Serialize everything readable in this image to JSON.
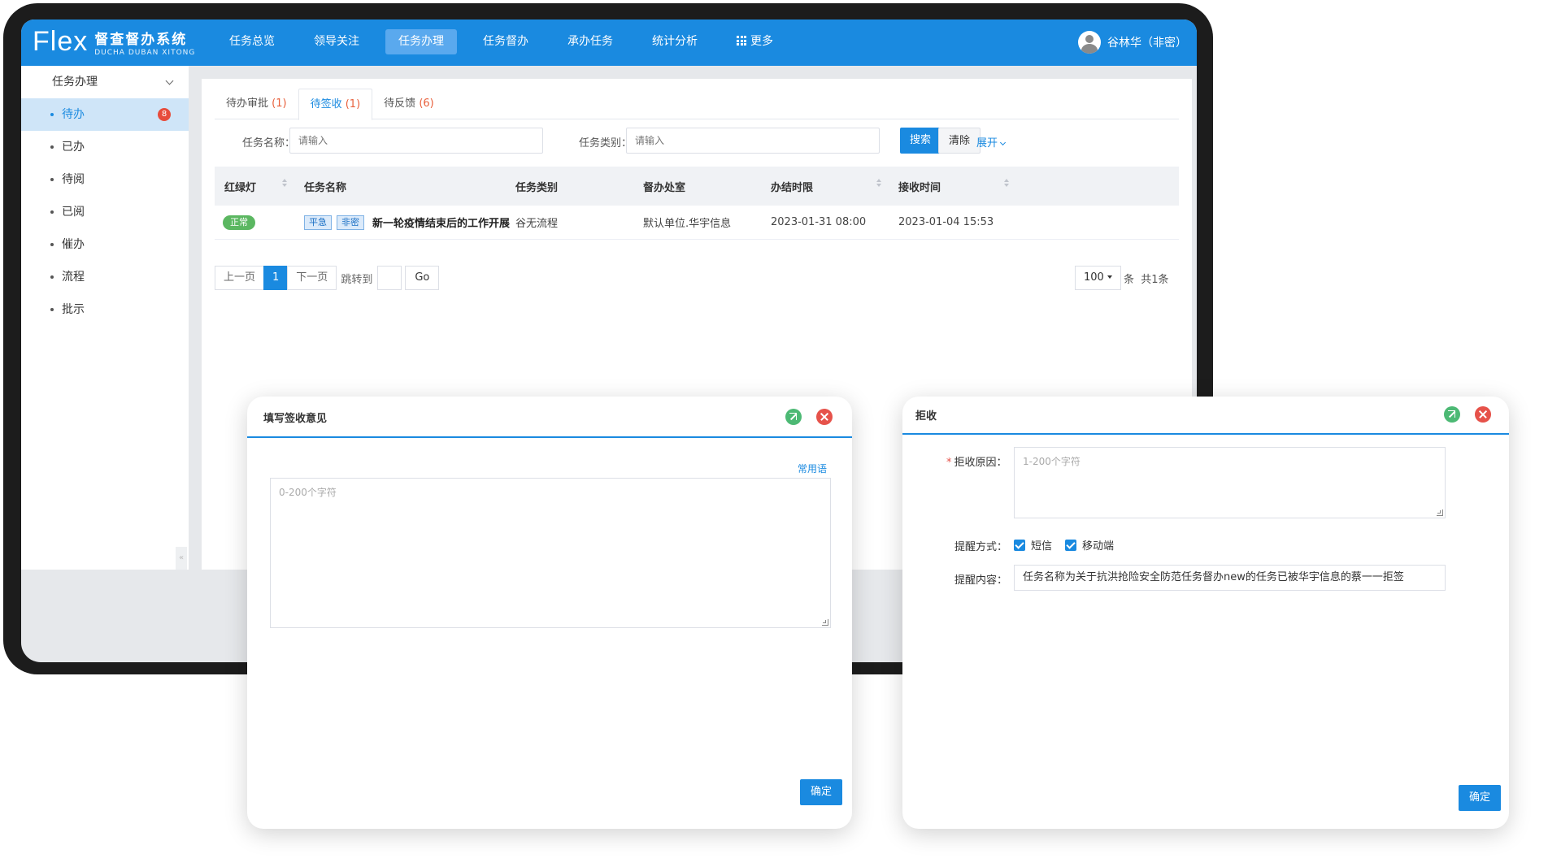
{
  "app": {
    "logo_mark": "Flex",
    "title_cn": "督查督办系统",
    "title_en": "DUCHA DUBAN XITONG"
  },
  "nav": {
    "items": [
      {
        "label": "任务总览"
      },
      {
        "label": "领导关注"
      },
      {
        "label": "任务办理",
        "active": true
      },
      {
        "label": "任务督办"
      },
      {
        "label": "承办任务"
      },
      {
        "label": "统计分析"
      },
      {
        "label": "更多",
        "icon": "grid-icon"
      }
    ],
    "user_name": "谷林华（非密）"
  },
  "sidebar": {
    "header": "任务办理",
    "items": [
      {
        "label": "待办",
        "badge": "8",
        "active": true
      },
      {
        "label": "已办"
      },
      {
        "label": "待阅"
      },
      {
        "label": "已阅"
      },
      {
        "label": "催办"
      },
      {
        "label": "流程"
      },
      {
        "label": "批示"
      }
    ],
    "collapse_glyph": "«"
  },
  "tabs": [
    {
      "label": "待办审批",
      "count": "(1)"
    },
    {
      "label": "待签收",
      "count": "(1)",
      "active": true
    },
    {
      "label": "待反馈",
      "count": "(6)"
    }
  ],
  "filter": {
    "name_label": "任务名称：",
    "name_placeholder": "请输入",
    "type_label": "任务类别：",
    "type_placeholder": "请输入",
    "search_label": "搜索",
    "clear_label": "清除",
    "expand_label": "展开"
  },
  "table": {
    "columns": [
      "红绿灯",
      "任务名称",
      "任务类别",
      "督办处室",
      "办结时限",
      "接收时间"
    ],
    "rows": [
      {
        "status": "正常",
        "tags": [
          "平急",
          "非密"
        ],
        "name": "新一轮疫情结束后的工作开展",
        "category": "谷无流程",
        "office": "默认单位.华宇信息",
        "deadline": "2023-01-31 08:00",
        "received": "2023-01-04 15:53"
      }
    ]
  },
  "pager": {
    "prev": "上一页",
    "current": "1",
    "next": "下一页",
    "jump_label": "跳转到",
    "go": "Go",
    "page_size": "100",
    "unit": "条",
    "total": "共1条"
  },
  "dialog_sign": {
    "title": "填写签收意见",
    "common_phrases": "常用语",
    "placeholder": "0-200个字符",
    "confirm": "确定"
  },
  "dialog_reject": {
    "title": "拒收",
    "reason_label": "拒收原因：",
    "reason_placeholder": "1-200个字符",
    "remind_label": "提醒方式：",
    "remind_options": [
      "短信",
      "移动端"
    ],
    "content_label": "提醒内容：",
    "content_value": "任务名称为关于抗洪抢险安全防范任务督办new的任务已被华宇信息的蔡一一拒签",
    "confirm": "确定"
  }
}
